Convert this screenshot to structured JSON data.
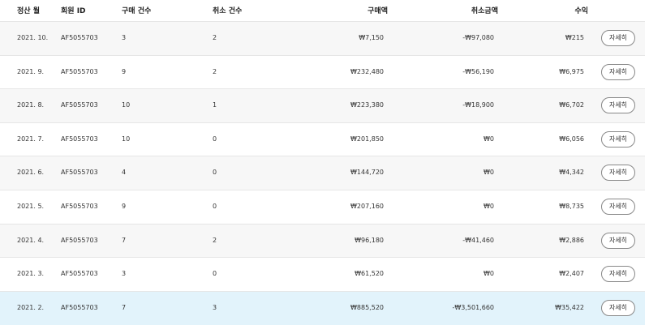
{
  "table": {
    "headers": {
      "month": "정산 월",
      "member_id": "회원 ID",
      "purchase_count": "구매 건수",
      "cancel_count": "취소 건수",
      "purchase_amount": "구매액",
      "cancel_amount": "취소금액",
      "profit": "수익"
    },
    "detail_label": "자세히",
    "rows": [
      {
        "month": "2021. 10.",
        "member_id": "AF5055703",
        "purchase_count": "3",
        "cancel_count": "2",
        "purchase_amount": "₩7,150",
        "cancel_amount": "-₩97,080",
        "profit": "₩215"
      },
      {
        "month": "2021. 9.",
        "member_id": "AF5055703",
        "purchase_count": "9",
        "cancel_count": "2",
        "purchase_amount": "₩232,480",
        "cancel_amount": "-₩56,190",
        "profit": "₩6,975"
      },
      {
        "month": "2021. 8.",
        "member_id": "AF5055703",
        "purchase_count": "10",
        "cancel_count": "1",
        "purchase_amount": "₩223,380",
        "cancel_amount": "-₩18,900",
        "profit": "₩6,702"
      },
      {
        "month": "2021. 7.",
        "member_id": "AF5055703",
        "purchase_count": "10",
        "cancel_count": "0",
        "purchase_amount": "₩201,850",
        "cancel_amount": "₩0",
        "profit": "₩6,056"
      },
      {
        "month": "2021. 6.",
        "member_id": "AF5055703",
        "purchase_count": "4",
        "cancel_count": "0",
        "purchase_amount": "₩144,720",
        "cancel_amount": "₩0",
        "profit": "₩4,342"
      },
      {
        "month": "2021. 5.",
        "member_id": "AF5055703",
        "purchase_count": "9",
        "cancel_count": "0",
        "purchase_amount": "₩207,160",
        "cancel_amount": "₩0",
        "profit": "₩8,735"
      },
      {
        "month": "2021. 4.",
        "member_id": "AF5055703",
        "purchase_count": "7",
        "cancel_count": "2",
        "purchase_amount": "₩96,180",
        "cancel_amount": "-₩41,460",
        "profit": "₩2,886"
      },
      {
        "month": "2021. 3.",
        "member_id": "AF5055703",
        "purchase_count": "3",
        "cancel_count": "0",
        "purchase_amount": "₩61,520",
        "cancel_amount": "₩0",
        "profit": "₩2,407"
      },
      {
        "month": "2021. 2.",
        "member_id": "AF5055703",
        "purchase_count": "7",
        "cancel_count": "3",
        "purchase_amount": "₩885,520",
        "cancel_amount": "-₩3,501,660",
        "profit": "₩35,422"
      }
    ],
    "selected_row_index": 8
  },
  "colors": {
    "row_odd": "#f7f7f7",
    "row_even": "#ffffff",
    "row_selected": "#e2f3fb",
    "border": "#e6e6e6",
    "button_border": "#888888"
  }
}
